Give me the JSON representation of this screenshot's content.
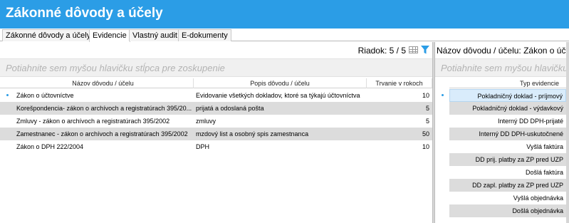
{
  "window": {
    "title": "Zákonné dôvody a účely"
  },
  "tabs": [
    {
      "label": "Zákonné dôvody a účely",
      "active": false
    },
    {
      "label": "Evidencie",
      "active": true
    },
    {
      "label": "Vlastný audit",
      "active": false
    },
    {
      "label": "E-dokumenty",
      "active": false
    }
  ],
  "left": {
    "row_count": "Riadok: 5 / 5",
    "group_hint": "Potiahnite sem myšou hlavičku stĺpca pre zoskupenie",
    "columns": [
      "Názov dôvodu / účelu",
      "Popis dôvodu / účelu",
      "Trvanie v rokoch"
    ],
    "rows": [
      {
        "name": "Zákon o účtovníctve",
        "desc": "Evidovanie všetkých dokladov, ktoré sa týkajú účtovníctva",
        "years": "10"
      },
      {
        "name": "Korešpondencia- zákon o archívoch a registratúrach 395/20...",
        "desc": "prijatá a odoslaná pošta",
        "years": "5"
      },
      {
        "name": "Zmluvy - zákon o archívoch a registratúrach 395/2002",
        "desc": "zmluvy",
        "years": "5"
      },
      {
        "name": "Zamestnanec - zákon o archívoch a registratúrach 395/2002",
        "desc": "mzdový list a osobný spis zamestnanca",
        "years": "50"
      },
      {
        "name": "Zákon o DPH 222/2004",
        "desc": "DPH",
        "years": "10"
      }
    ]
  },
  "right": {
    "title": "Názov dôvodu / účelu: Zákon o účtovníctve",
    "group_hint": "Potiahnite sem myšou hlavičku stĺpca pre zoskupenie",
    "column": "Typ evidencie",
    "rows": [
      "Pokladničný doklad - príjmový",
      "Pokladničný doklad - výdavkový",
      "Interný DD DPH-prijaté",
      "Interný DD DPH-uskutočnené",
      "Vyšlá faktúra",
      "DD prij. platby za ZP pred UZP",
      "Došlá faktúra",
      "DD zapl. platby za ZP pred UZP",
      "Vyšlá objednávka",
      "Došlá objednávka"
    ]
  },
  "colors": {
    "accent": "#2b9de6",
    "row_alt": "#dcdcdc",
    "row_selected": "#d9ecfb"
  },
  "icons": [
    "grid-layout-icon",
    "filter-icon"
  ]
}
